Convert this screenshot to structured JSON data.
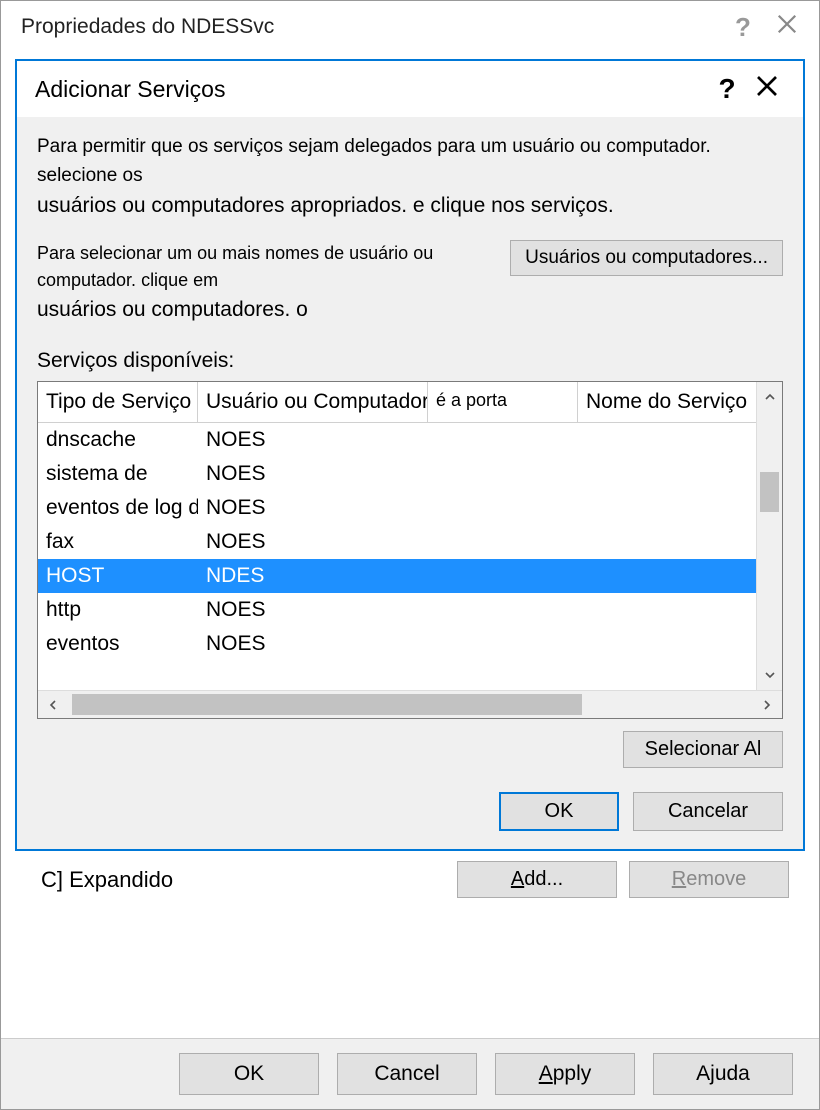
{
  "outer": {
    "title": "Propriedades do NDESSvc",
    "help": "?",
    "close": "×"
  },
  "dialog": {
    "title": "Adicionar Serviços",
    "help": "?",
    "instr1a": "Para permitir que os serviços sejam delegados para um usuário ou computador. selecione os",
    "instr1b": "usuários ou computadores apropriados. e clique nos serviços.",
    "instr2a": "Para selecionar um ou mais nomes de usuário ou computador. clique em",
    "instr2b": "usuários ou computadores. o",
    "btn_users": "Usuários ou computadores...",
    "avail_label": "Serviços disponíveis:",
    "headers": {
      "a": "Tipo de Serviço",
      "b": "Usuário ou Computador",
      "c": "é a porta",
      "d": "Nome do Serviço"
    },
    "rows": [
      {
        "a": "dnscache",
        "b": "NOES",
        "c": "",
        "d": "",
        "selected": false
      },
      {
        "a": "sistema de",
        "b": "NOES",
        "c": "",
        "d": "",
        "selected": false
      },
      {
        "a": "eventos de log de",
        "b": "NOES",
        "c": "",
        "d": "",
        "selected": false
      },
      {
        "a": "fax",
        "b": "NOES",
        "c": "",
        "d": "",
        "selected": false
      },
      {
        "a": "HOST",
        "b": "NDES",
        "c": "",
        "d": "",
        "selected": true
      },
      {
        "a": "http",
        "b": "NOES",
        "c": "",
        "d": "",
        "selected": false
      },
      {
        "a": "eventos",
        "b": "NOES",
        "c": "",
        "d": "",
        "selected": false
      }
    ],
    "btn_selectall": "Selecionar Al",
    "btn_ok": "OK",
    "btn_cancel": "Cancelar"
  },
  "parent": {
    "expanded_label": "C] Expandido",
    "btn_add": "Add...",
    "btn_remove": "Remove"
  },
  "bottom": {
    "ok": "OK",
    "cancel": "Cancel",
    "apply": "Apply",
    "help": "Ajuda"
  }
}
